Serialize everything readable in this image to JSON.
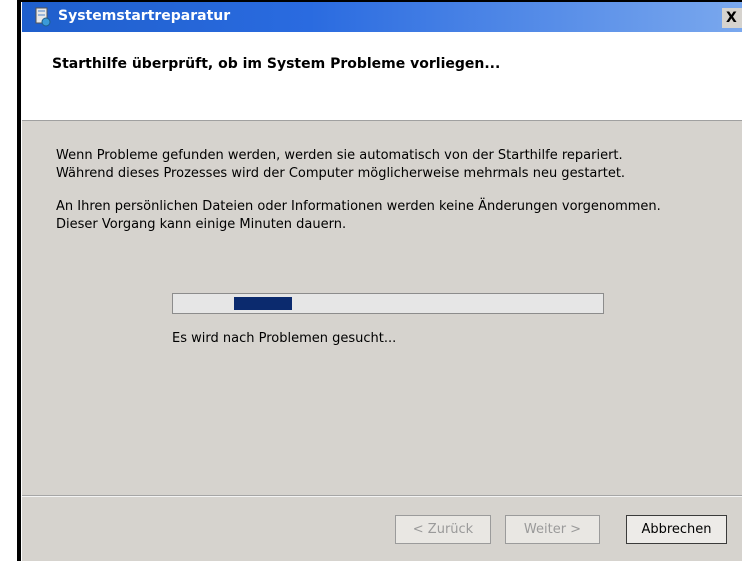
{
  "window": {
    "title": "Systemstartreparatur",
    "close_glyph": "X",
    "icon": "system-repair-icon"
  },
  "header": {
    "text": "Starthilfe überprüft, ob im System Probleme vorliegen..."
  },
  "body": {
    "paragraph1_line1": "Wenn Probleme gefunden werden, werden sie automatisch von der Starthilfe repariert.",
    "paragraph1_line2": "Während dieses Prozesses wird der Computer möglicherweise mehrmals neu gestartet.",
    "paragraph2_line1": "An Ihren persönlichen Dateien oder Informationen werden keine Änderungen vorgenommen.",
    "paragraph2_line2": "Dieser Vorgang kann einige Minuten dauern.",
    "status": "Es wird nach Problemen gesucht...",
    "progress": {
      "type": "marquee",
      "accent_color": "#0b2a6e"
    }
  },
  "buttons": {
    "back": "< Zurück",
    "next": "Weiter >",
    "cancel": "Abbrechen"
  }
}
